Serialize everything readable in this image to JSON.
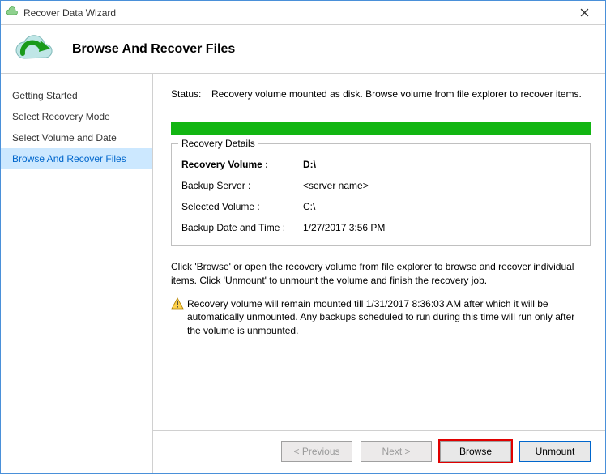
{
  "window": {
    "title": "Recover Data Wizard"
  },
  "header": {
    "title": "Browse And Recover Files"
  },
  "sidebar": {
    "items": [
      {
        "label": "Getting Started",
        "active": false
      },
      {
        "label": "Select Recovery Mode",
        "active": false
      },
      {
        "label": "Select Volume and Date",
        "active": false
      },
      {
        "label": "Browse And Recover Files",
        "active": true
      }
    ]
  },
  "status": {
    "label": "Status:",
    "value": "Recovery volume mounted as disk. Browse volume from file explorer to recover items."
  },
  "recovery_details": {
    "legend": "Recovery Details",
    "fields": {
      "recovery_volume_label": "Recovery Volume :",
      "recovery_volume_value": "D:\\",
      "backup_server_label": "Backup Server :",
      "backup_server_value": "<server name>",
      "selected_volume_label": "Selected Volume :",
      "selected_volume_value": "C:\\",
      "backup_datetime_label": "Backup Date and Time :",
      "backup_datetime_value": "1/27/2017 3:56 PM"
    }
  },
  "instructions": "Click 'Browse' or open the recovery volume from file explorer to browse and recover individual items. Click 'Unmount' to unmount the volume and finish the recovery job.",
  "warning": "Recovery volume will remain mounted till 1/31/2017 8:36:03 AM after which it will be automatically unmounted. Any backups scheduled to run during this time will run only after the volume is unmounted.",
  "buttons": {
    "previous": "< Previous",
    "next": "Next >",
    "browse": "Browse",
    "unmount": "Unmount"
  }
}
